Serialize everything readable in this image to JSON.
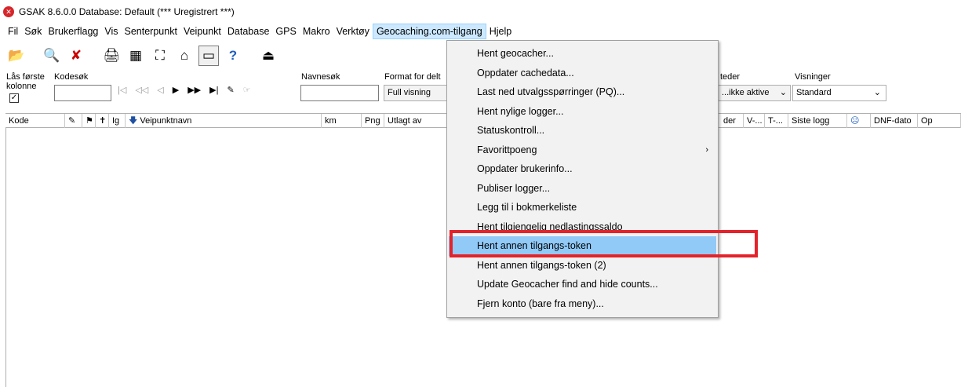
{
  "window": {
    "title": "GSAK 8.6.0.0   Database: Default   (*** Uregistrert ***)"
  },
  "menubar": {
    "items": [
      "Fil",
      "Søk",
      "Brukerflagg",
      "Vis",
      "Senterpunkt",
      "Veipunkt",
      "Database",
      "GPS",
      "Makro",
      "Verktøy",
      "Geocaching.com-tilgang",
      "Hjelp"
    ],
    "active_index": 10
  },
  "filters": {
    "lock_label": "Lås første kolonne",
    "lock_checked": true,
    "code_search_label": "Kodesøk",
    "name_search_label": "Navnesøk",
    "format_label": "Format for delt",
    "format_value": "Full visning",
    "places_label": "teder",
    "places_value": "...ikke aktive",
    "views_label": "Visninger",
    "views_value": "Standard"
  },
  "grid": {
    "columns": [
      "Kode",
      "Ig",
      "Veipunktnavn",
      "km",
      "Png",
      "Utlagt av",
      "der",
      "V-...",
      "T-...",
      "Siste logg",
      "DNF-dato",
      "Op"
    ]
  },
  "dropdown": {
    "items": [
      {
        "label": "Hent geocacher..."
      },
      {
        "label": "Oppdater cachedata..."
      },
      {
        "label": "Last ned utvalgsspørringer (PQ)..."
      },
      {
        "label": "Hent nylige logger..."
      },
      {
        "label": "Statuskontroll..."
      },
      {
        "label": "Favorittpoeng",
        "submenu": true
      },
      {
        "label": "Oppdater brukerinfo..."
      },
      {
        "label": "Publiser logger..."
      },
      {
        "label": "Legg til i bokmerkeliste"
      },
      {
        "label": "Hent tilgjengelig nedlastingssaldo"
      },
      {
        "label": "Hent annen tilgangs-token",
        "highlighted": true
      },
      {
        "label": "Hent annen tilgangs-token (2)"
      },
      {
        "label": "Update Geocacher find and hide counts..."
      },
      {
        "label": "Fjern konto (bare fra meny)..."
      }
    ]
  },
  "colors": {
    "highlight": "#91c9f7",
    "annotation_box": "#e4222a",
    "active_menu": "#cce8ff"
  }
}
